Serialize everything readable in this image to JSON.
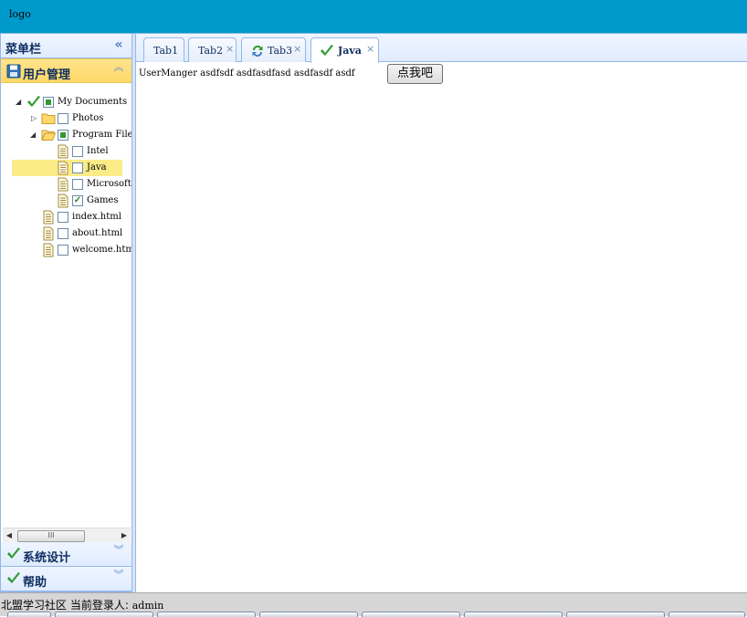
{
  "header": {
    "logo": "logo"
  },
  "west": {
    "title": "菜单栏",
    "collapse_icon": "double-chevron-left-icon",
    "accordion": [
      {
        "label": "用户管理",
        "icon": "save-disk-icon",
        "selected": true
      },
      {
        "label": "系统设计",
        "icon": "checkmark-icon",
        "selected": false
      },
      {
        "label": "帮助",
        "icon": "checkmark-icon",
        "selected": false
      }
    ],
    "tree": [
      {
        "label": "My Documents",
        "check": "partial",
        "icon": "checkmark-icon",
        "expanded": true
      },
      {
        "label": "Photos",
        "check": "unchecked",
        "icon": "folder-icon",
        "expanded": false
      },
      {
        "label": "Program Files",
        "check": "partial",
        "icon": "folder-open-icon",
        "expanded": true
      },
      {
        "label": "Intel",
        "check": "unchecked",
        "icon": "file-icon"
      },
      {
        "label": "Java",
        "check": "unchecked",
        "icon": "file-icon",
        "selected": true
      },
      {
        "label": "Microsoft Office",
        "check": "unchecked",
        "icon": "file-icon"
      },
      {
        "label": "Games",
        "check": "checked",
        "icon": "file-icon"
      },
      {
        "label": "index.html",
        "check": "unchecked",
        "icon": "file-icon"
      },
      {
        "label": "about.html",
        "check": "unchecked",
        "icon": "file-icon"
      },
      {
        "label": "welcome.html",
        "check": "unchecked",
        "icon": "file-icon"
      }
    ]
  },
  "tabs": [
    {
      "label": "Tab1",
      "closable": false,
      "selected": false
    },
    {
      "label": "Tab2",
      "closable": true,
      "selected": false
    },
    {
      "label": "Tab3",
      "closable": true,
      "selected": false,
      "icon": "reload-icon"
    },
    {
      "label": "Java",
      "closable": true,
      "selected": true,
      "icon": "checkmark-icon"
    }
  ],
  "content": {
    "text": "UserManger asdfsdf asdfasdfasd asdfasdf asdf",
    "button": "点我吧"
  },
  "footer": {
    "org": "北盟学习社区",
    "login_label": "当前登录人:",
    "user": "admin"
  },
  "colors": {
    "header": "#0099cc",
    "border": "#95b8e7",
    "selected": "#ffe48d",
    "check": "#2e9a2e"
  }
}
